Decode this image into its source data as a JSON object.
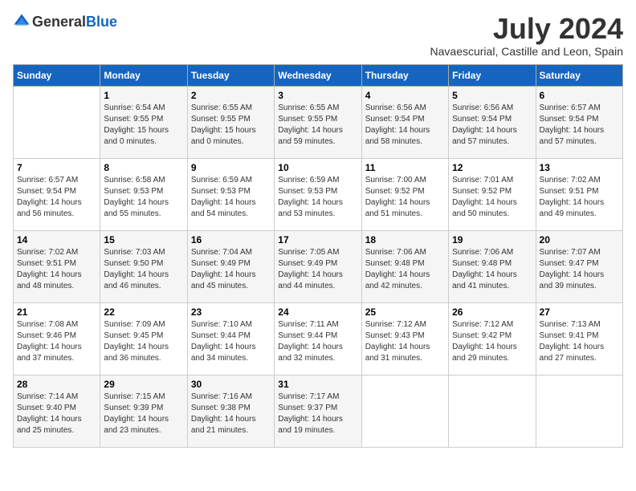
{
  "header": {
    "logo_general": "General",
    "logo_blue": "Blue",
    "month_year": "July 2024",
    "location": "Navaescurial, Castille and Leon, Spain"
  },
  "calendar": {
    "days_of_week": [
      "Sunday",
      "Monday",
      "Tuesday",
      "Wednesday",
      "Thursday",
      "Friday",
      "Saturday"
    ],
    "weeks": [
      [
        {
          "day": "",
          "info": ""
        },
        {
          "day": "1",
          "info": "Sunrise: 6:54 AM\nSunset: 9:55 PM\nDaylight: 15 hours\nand 0 minutes."
        },
        {
          "day": "2",
          "info": "Sunrise: 6:55 AM\nSunset: 9:55 PM\nDaylight: 15 hours\nand 0 minutes."
        },
        {
          "day": "3",
          "info": "Sunrise: 6:55 AM\nSunset: 9:55 PM\nDaylight: 14 hours\nand 59 minutes."
        },
        {
          "day": "4",
          "info": "Sunrise: 6:56 AM\nSunset: 9:54 PM\nDaylight: 14 hours\nand 58 minutes."
        },
        {
          "day": "5",
          "info": "Sunrise: 6:56 AM\nSunset: 9:54 PM\nDaylight: 14 hours\nand 57 minutes."
        },
        {
          "day": "6",
          "info": "Sunrise: 6:57 AM\nSunset: 9:54 PM\nDaylight: 14 hours\nand 57 minutes."
        }
      ],
      [
        {
          "day": "7",
          "info": "Sunrise: 6:57 AM\nSunset: 9:54 PM\nDaylight: 14 hours\nand 56 minutes."
        },
        {
          "day": "8",
          "info": "Sunrise: 6:58 AM\nSunset: 9:53 PM\nDaylight: 14 hours\nand 55 minutes."
        },
        {
          "day": "9",
          "info": "Sunrise: 6:59 AM\nSunset: 9:53 PM\nDaylight: 14 hours\nand 54 minutes."
        },
        {
          "day": "10",
          "info": "Sunrise: 6:59 AM\nSunset: 9:53 PM\nDaylight: 14 hours\nand 53 minutes."
        },
        {
          "day": "11",
          "info": "Sunrise: 7:00 AM\nSunset: 9:52 PM\nDaylight: 14 hours\nand 51 minutes."
        },
        {
          "day": "12",
          "info": "Sunrise: 7:01 AM\nSunset: 9:52 PM\nDaylight: 14 hours\nand 50 minutes."
        },
        {
          "day": "13",
          "info": "Sunrise: 7:02 AM\nSunset: 9:51 PM\nDaylight: 14 hours\nand 49 minutes."
        }
      ],
      [
        {
          "day": "14",
          "info": "Sunrise: 7:02 AM\nSunset: 9:51 PM\nDaylight: 14 hours\nand 48 minutes."
        },
        {
          "day": "15",
          "info": "Sunrise: 7:03 AM\nSunset: 9:50 PM\nDaylight: 14 hours\nand 46 minutes."
        },
        {
          "day": "16",
          "info": "Sunrise: 7:04 AM\nSunset: 9:49 PM\nDaylight: 14 hours\nand 45 minutes."
        },
        {
          "day": "17",
          "info": "Sunrise: 7:05 AM\nSunset: 9:49 PM\nDaylight: 14 hours\nand 44 minutes."
        },
        {
          "day": "18",
          "info": "Sunrise: 7:06 AM\nSunset: 9:48 PM\nDaylight: 14 hours\nand 42 minutes."
        },
        {
          "day": "19",
          "info": "Sunrise: 7:06 AM\nSunset: 9:48 PM\nDaylight: 14 hours\nand 41 minutes."
        },
        {
          "day": "20",
          "info": "Sunrise: 7:07 AM\nSunset: 9:47 PM\nDaylight: 14 hours\nand 39 minutes."
        }
      ],
      [
        {
          "day": "21",
          "info": "Sunrise: 7:08 AM\nSunset: 9:46 PM\nDaylight: 14 hours\nand 37 minutes."
        },
        {
          "day": "22",
          "info": "Sunrise: 7:09 AM\nSunset: 9:45 PM\nDaylight: 14 hours\nand 36 minutes."
        },
        {
          "day": "23",
          "info": "Sunrise: 7:10 AM\nSunset: 9:44 PM\nDaylight: 14 hours\nand 34 minutes."
        },
        {
          "day": "24",
          "info": "Sunrise: 7:11 AM\nSunset: 9:44 PM\nDaylight: 14 hours\nand 32 minutes."
        },
        {
          "day": "25",
          "info": "Sunrise: 7:12 AM\nSunset: 9:43 PM\nDaylight: 14 hours\nand 31 minutes."
        },
        {
          "day": "26",
          "info": "Sunrise: 7:12 AM\nSunset: 9:42 PM\nDaylight: 14 hours\nand 29 minutes."
        },
        {
          "day": "27",
          "info": "Sunrise: 7:13 AM\nSunset: 9:41 PM\nDaylight: 14 hours\nand 27 minutes."
        }
      ],
      [
        {
          "day": "28",
          "info": "Sunrise: 7:14 AM\nSunset: 9:40 PM\nDaylight: 14 hours\nand 25 minutes."
        },
        {
          "day": "29",
          "info": "Sunrise: 7:15 AM\nSunset: 9:39 PM\nDaylight: 14 hours\nand 23 minutes."
        },
        {
          "day": "30",
          "info": "Sunrise: 7:16 AM\nSunset: 9:38 PM\nDaylight: 14 hours\nand 21 minutes."
        },
        {
          "day": "31",
          "info": "Sunrise: 7:17 AM\nSunset: 9:37 PM\nDaylight: 14 hours\nand 19 minutes."
        },
        {
          "day": "",
          "info": ""
        },
        {
          "day": "",
          "info": ""
        },
        {
          "day": "",
          "info": ""
        }
      ]
    ]
  }
}
